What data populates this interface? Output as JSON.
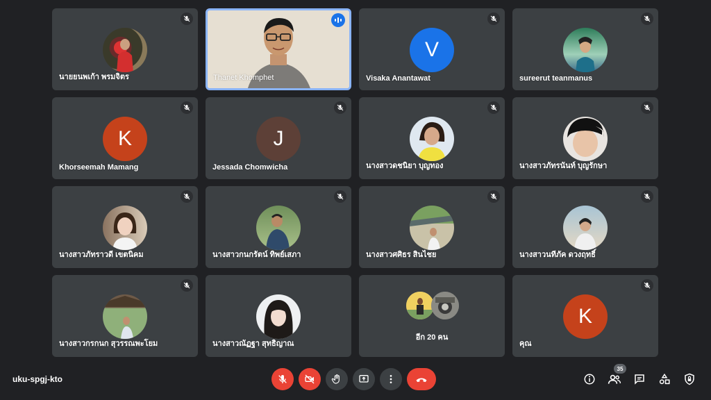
{
  "participants": [
    {
      "name": "นายยนพเก้า พรมจิตร",
      "type": "photo"
    },
    {
      "name": "Thanet Khomphet",
      "type": "video"
    },
    {
      "name": "Visaka Anantawat",
      "type": "letter",
      "initial": "V",
      "color": "#1a73e8"
    },
    {
      "name": "sureerut teanmanus",
      "type": "photo"
    },
    {
      "name": "Khorseemah Mamang",
      "type": "letter",
      "initial": "K",
      "color": "#c5421b"
    },
    {
      "name": "Jessada Chomwicha",
      "type": "letter",
      "initial": "J",
      "color": "#5d4037"
    },
    {
      "name": "นางสาวดชนิยา บุญทอง",
      "type": "photo"
    },
    {
      "name": "นางสาวภัทรนันท์ บุญรักษา",
      "type": "photo"
    },
    {
      "name": "นางสาวภัทราวดี เขตนิคม",
      "type": "photo"
    },
    {
      "name": "นางสาวกนกรัตน์ ทิพย์เสภา",
      "type": "photo"
    },
    {
      "name": "นางสาวศศิธร สินไชย",
      "type": "photo"
    },
    {
      "name": "นางสาวนทีภัค ดวงฤทธิ์",
      "type": "photo"
    },
    {
      "name": "นางสาวกรกนก สุวรรณพะโยม",
      "type": "photo"
    },
    {
      "name": "นางสาวณัฏฐา สุทธิญาณ",
      "type": "photo"
    },
    {
      "name": "อีก 20 คน",
      "type": "more"
    },
    {
      "name": "คุณ",
      "type": "letter",
      "initial": "K",
      "color": "#c5421b"
    }
  ],
  "meeting": {
    "code": "uku-spgj-kto",
    "participant_count": "35"
  },
  "icons": {
    "muted": "mic-off-icon",
    "speaking": "audio-level-icon",
    "mic": "mic-off-icon",
    "camera": "camera-off-icon",
    "hand": "raise-hand-icon",
    "present": "present-screen-icon",
    "more": "more-vert-icon",
    "end": "end-call-icon",
    "info": "info-icon",
    "people": "people-icon",
    "chat": "chat-icon",
    "activities": "activities-icon",
    "host": "host-controls-icon"
  }
}
